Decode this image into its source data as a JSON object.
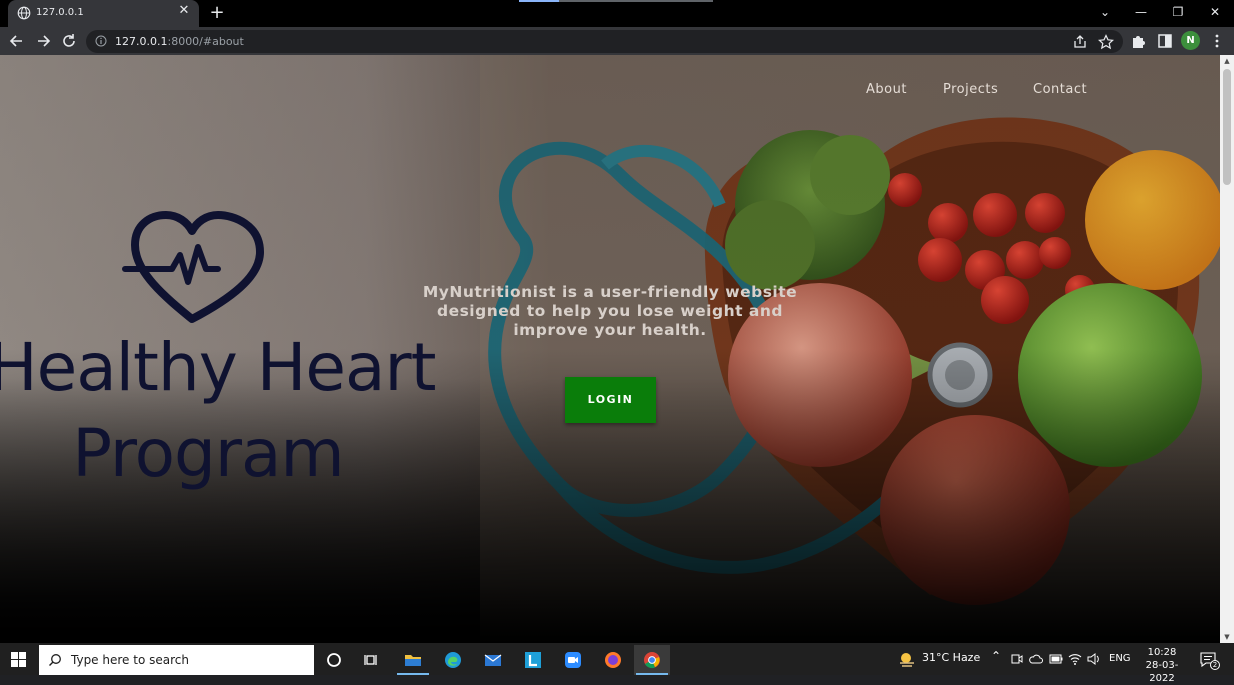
{
  "browser": {
    "tab_title": "127.0.0.1",
    "url_host": "127.0.0.1",
    "url_path": ":8000/#about",
    "profile_initial": "N"
  },
  "site": {
    "nav": [
      "About",
      "Projects",
      "Contact"
    ],
    "logo_title_line1": "Healthy Heart",
    "logo_title_line2": "Program",
    "tagline": "MyNutritionist is a user-friendly website designed to help you lose weight and improve your health.",
    "login_label": "LOGIN"
  },
  "taskbar": {
    "search_placeholder": "Type here to search",
    "weather": "31°C  Haze",
    "language": "ENG",
    "time": "10:28",
    "date": "28-03-2022",
    "notification_count": "2"
  },
  "colors": {
    "login_button": "#0a7d0a",
    "logo_ink": "#0f1230"
  }
}
